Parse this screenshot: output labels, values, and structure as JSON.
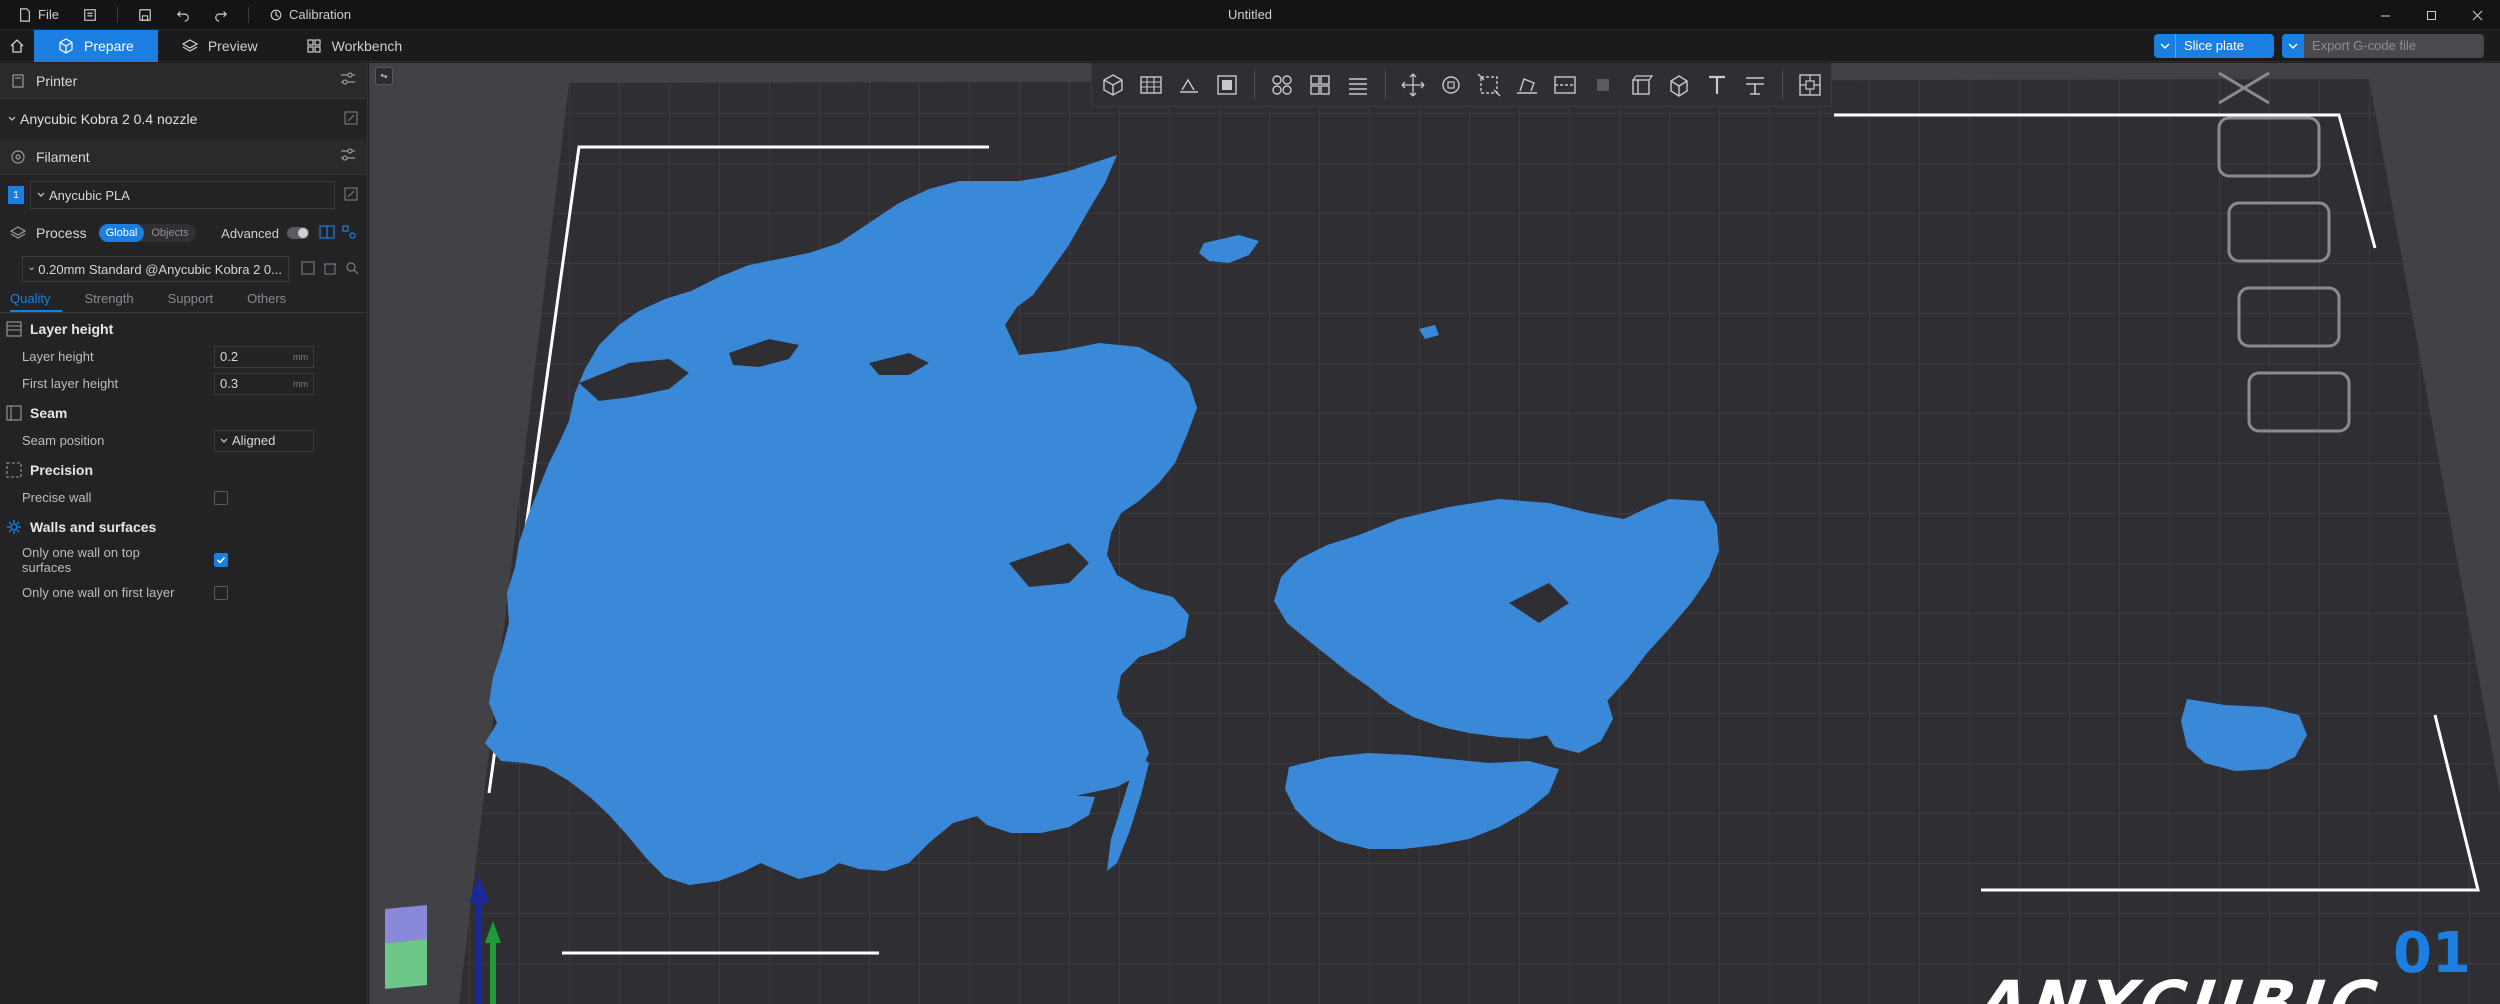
{
  "titlebar": {
    "file_label": "File",
    "calibration_label": "Calibration",
    "window_title": "Untitled"
  },
  "tabs": [
    {
      "label": "Prepare"
    },
    {
      "label": "Preview"
    },
    {
      "label": "Workbench"
    }
  ],
  "actions": {
    "slice_label": "Slice plate",
    "export_label": "Export G-code file"
  },
  "printer": {
    "header": "Printer",
    "selected": "Anycubic Kobra 2 0.4 nozzle"
  },
  "filament": {
    "header": "Filament",
    "slot_number": "1",
    "selected": "Anycubic PLA"
  },
  "process": {
    "header": "Process",
    "scope_options": [
      "Global",
      "Objects"
    ],
    "advanced_label": "Advanced",
    "preset": "0.20mm Standard @Anycubic Kobra 2 0...",
    "subtabs": [
      "Quality",
      "Strength",
      "Support",
      "Others"
    ]
  },
  "quality": {
    "layer_height_group": "Layer height",
    "layer_height_label": "Layer height",
    "layer_height_value": "0.2",
    "first_layer_height_label": "First layer height",
    "first_layer_height_value": "0.3",
    "unit_mm": "mm",
    "seam_group": "Seam",
    "seam_position_label": "Seam position",
    "seam_position_value": "Aligned",
    "precision_group": "Precision",
    "precise_wall_label": "Precise wall",
    "walls_group": "Walls and surfaces",
    "one_wall_top_label": "Only one wall on top surfaces",
    "one_wall_first_label": "Only one wall on first layer"
  },
  "viewport": {
    "brand_text": "ANYCUBIC",
    "plate_number": "01"
  },
  "colors": {
    "accent": "#1a7fe0",
    "model": "#3a88d8",
    "bed": "#2f2f33"
  }
}
